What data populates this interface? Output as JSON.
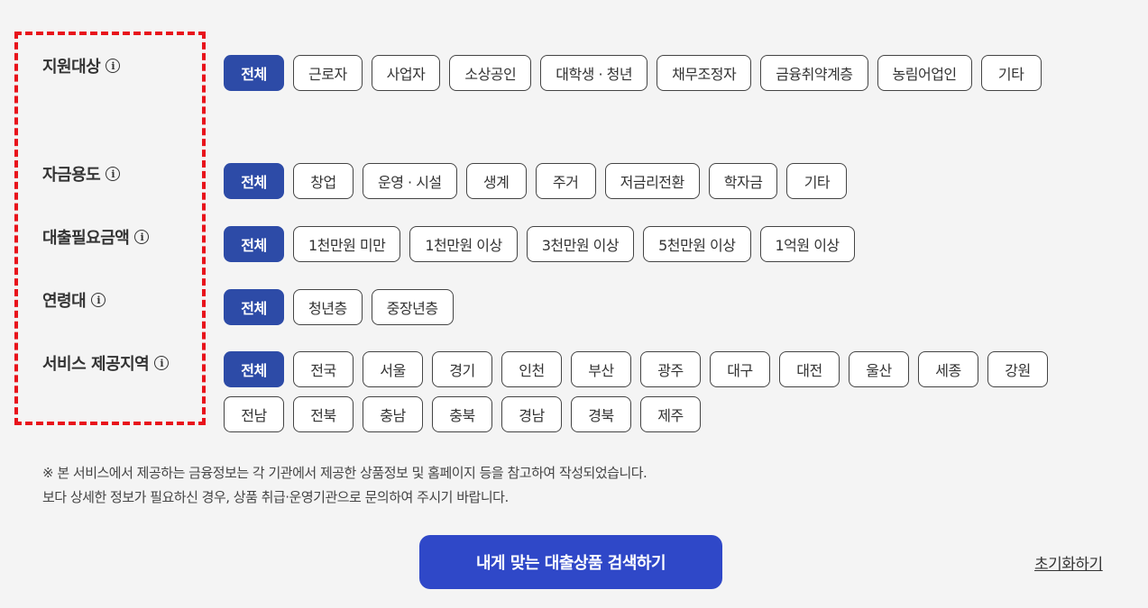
{
  "filters": {
    "target": {
      "label": "지원대상",
      "options": [
        "전체",
        "근로자",
        "사업자",
        "소상공인",
        "대학생 · 청년",
        "채무조정자",
        "금융취약계층",
        "농림어업인",
        "기타"
      ],
      "selected": 0
    },
    "purpose": {
      "label": "자금용도",
      "options": [
        "전체",
        "창업",
        "운영 · 시설",
        "생계",
        "주거",
        "저금리전환",
        "학자금",
        "기타"
      ],
      "selected": 0
    },
    "amount": {
      "label": "대출필요금액",
      "options": [
        "전체",
        "1천만원 미만",
        "1천만원 이상",
        "3천만원 이상",
        "5천만원 이상",
        "1억원 이상"
      ],
      "selected": 0
    },
    "age": {
      "label": "연령대",
      "options": [
        "전체",
        "청년층",
        "중장년층"
      ],
      "selected": 0
    },
    "region": {
      "label": "서비스 제공지역",
      "options": [
        "전체",
        "전국",
        "서울",
        "경기",
        "인천",
        "부산",
        "광주",
        "대구",
        "대전",
        "울산",
        "세종",
        "강원",
        "전남",
        "전북",
        "충남",
        "충북",
        "경남",
        "경북",
        "제주"
      ],
      "selected": 0
    }
  },
  "info_icon_glyph": "i",
  "notice": {
    "line1": "※ 본 서비스에서 제공하는 금융정보는 각 기관에서 제공한 상품정보 및 홈페이지 등을 참고하여 작성되었습니다.",
    "line2": "보다 상세한 정보가 필요하신 경우, 상품 취급·운영기관으로 문의하여 주시기 바랍니다."
  },
  "actions": {
    "search_label": "내게 맞는 대출상품 검색하기",
    "reset_label": "초기화하기"
  },
  "colors": {
    "selected_chip": "#2d4ba7",
    "search_button": "#2f48c8",
    "highlight": "#e8131b"
  }
}
